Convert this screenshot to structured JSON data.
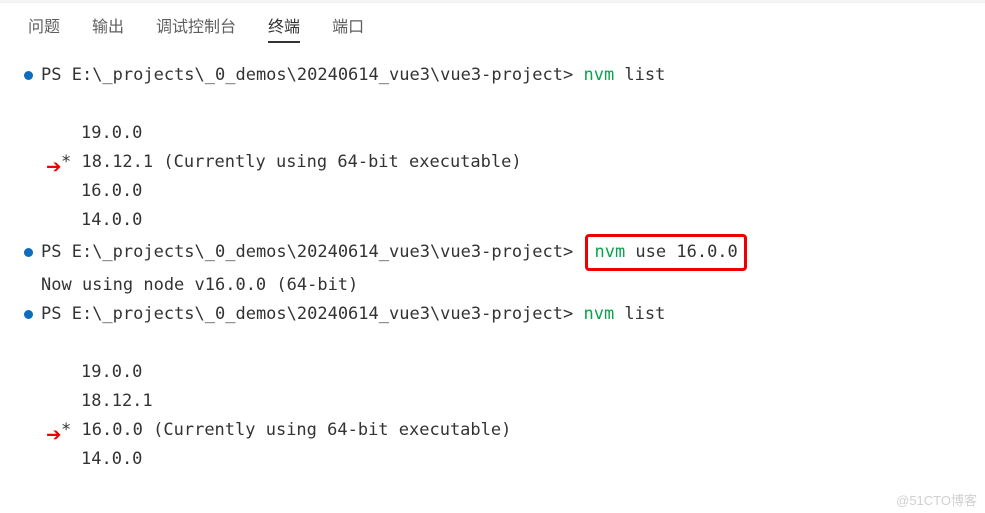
{
  "tabs": {
    "problems": "问题",
    "output": "输出",
    "debug_console": "调试控制台",
    "terminal": "终端",
    "ports": "端口"
  },
  "terminal": {
    "prompt1_ps": "PS ",
    "prompt1_path": "E:\\_projects\\_0_demos\\20240614_vue3\\vue3-project> ",
    "cmd1_nvm": "nvm ",
    "cmd1_args": "list",
    "list1": {
      "v19": "19.0.0",
      "active_marker": "* ",
      "v18": "18.12.1",
      "active_suffix": " (Currently using 64-bit executable)",
      "v16": "16.0.0",
      "v14": "14.0.0"
    },
    "prompt2_ps": "PS ",
    "prompt2_path": "E:\\_projects\\_0_demos\\20240614_vue3\\vue3-project> ",
    "cmd2_nvm": "nvm ",
    "cmd2_args": "use 16.0.0",
    "result2": "Now using node v16.0.0 (64-bit)",
    "prompt3_ps": "PS ",
    "prompt3_path": "E:\\_projects\\_0_demos\\20240614_vue3\\vue3-project> ",
    "cmd3_nvm": "nvm ",
    "cmd3_args": "list",
    "list2": {
      "v19": "19.0.0",
      "v18": "18.12.1",
      "active_marker": "* ",
      "v16": "16.0.0",
      "active_suffix": " (Currently using 64-bit executable)",
      "v14": "14.0.0"
    }
  },
  "watermark": "@51CTO博客"
}
